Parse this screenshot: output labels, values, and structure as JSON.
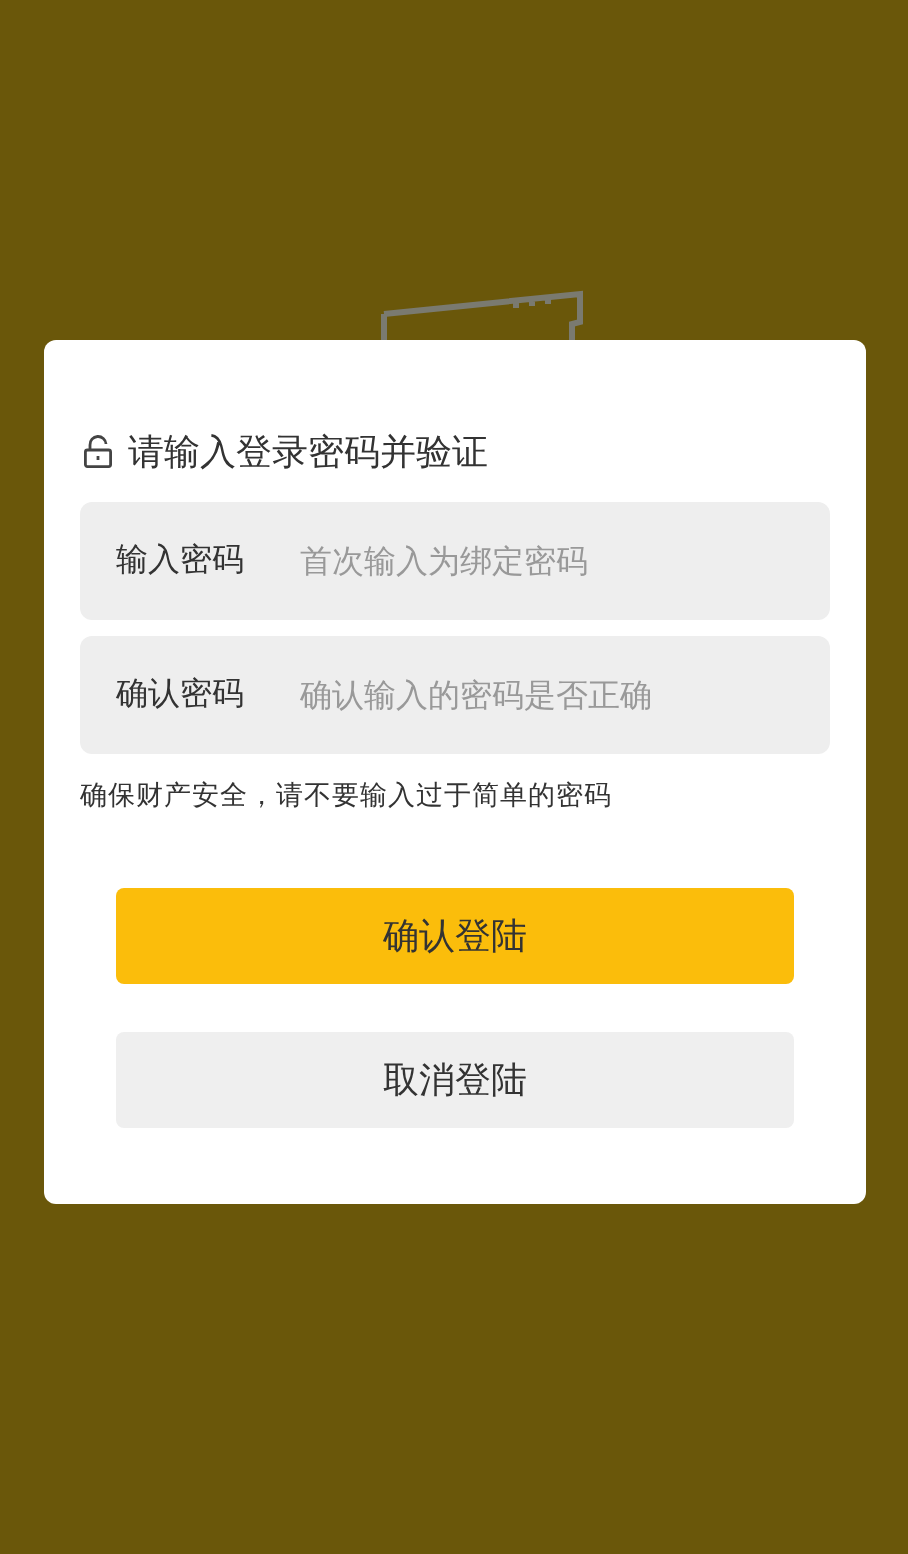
{
  "dialog": {
    "title": "请输入登录密码并验证",
    "fields": [
      {
        "label": "输入密码",
        "placeholder": "首次输入为绑定密码"
      },
      {
        "label": "确认密码",
        "placeholder": "确认输入的密码是否正确"
      }
    ],
    "hint": "确保财产安全，请不要输入过于简单的密码",
    "buttons": [
      {
        "label": "确认登陆",
        "kind": "primary"
      },
      {
        "label": "取消登陆",
        "kind": "secondary"
      }
    ]
  }
}
